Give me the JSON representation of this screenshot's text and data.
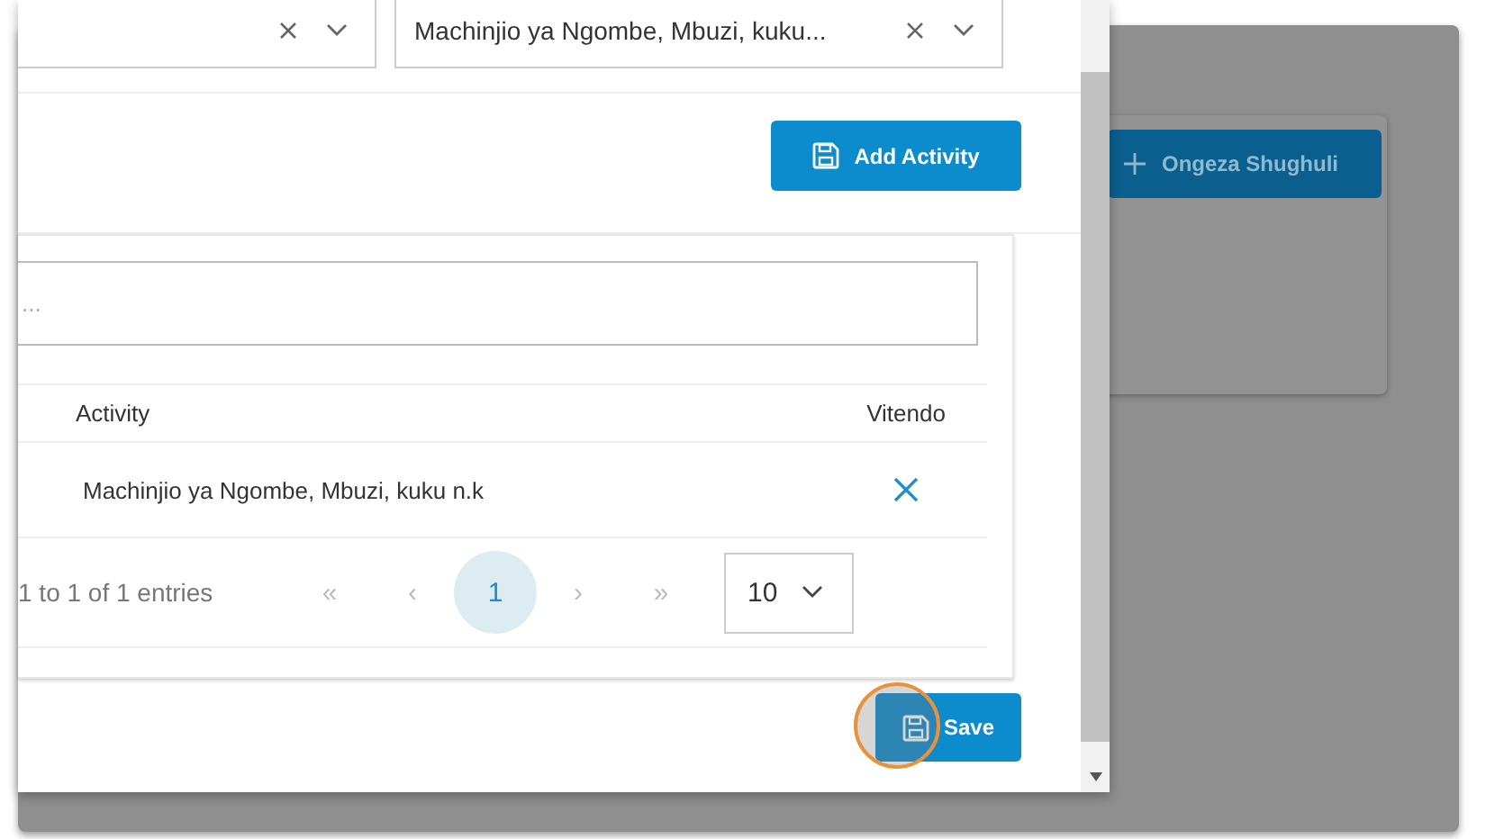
{
  "filters": [
    {
      "clearable": true
    },
    {
      "value": "Machinjio ya Ngombe, Mbuzi, kuku...",
      "clearable": true
    }
  ],
  "add_button": {
    "label": "Add Activity"
  },
  "search": {
    "placeholder": "..."
  },
  "table": {
    "columns": [
      "Activity",
      "Vitendo"
    ],
    "rows": [
      {
        "activity": "Machinjio ya Ngombe, Mbuzi, kuku n.k"
      }
    ]
  },
  "pagination": {
    "summary": "1 to 1 of 1 entries",
    "first": "«",
    "prev": "‹",
    "pages": [
      {
        "label": "1",
        "selected": true
      }
    ],
    "next": "›",
    "last": "»",
    "page_size": "10"
  },
  "save_button": {
    "label": "Save",
    "highlighted": true
  },
  "background": {
    "button": {
      "label": "Ongeza Shughuli"
    }
  }
}
